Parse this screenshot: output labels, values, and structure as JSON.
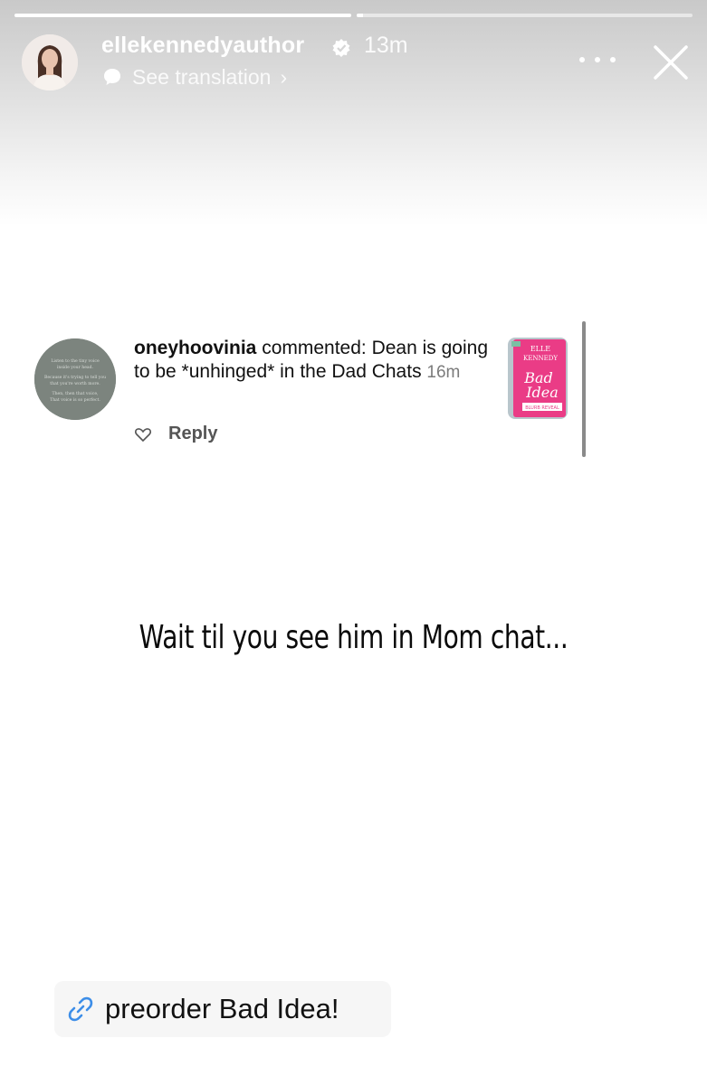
{
  "story": {
    "progress": [
      1.0,
      0.02
    ],
    "username": "ellekennedyauthor",
    "time_ago": "13m",
    "translate_label": "See translation"
  },
  "comment": {
    "username": "oneyhoovinia",
    "text": " commented: Dean is going to be *unhinged* in the Dad Chats",
    "time_ago": "16m",
    "reply_label": "Reply",
    "avatar_quote_lines": [
      "Listen to the tiny voice",
      "inside your head.",
      "Because it's trying to tell you",
      "that you're worth more.",
      "Then, then that voice,",
      "That voice is so perfect."
    ],
    "book": {
      "author": "ELLE KENNEDY",
      "title_line1": "Bad",
      "title_line2": "Idea",
      "tag": "BLURB REVEAL"
    }
  },
  "caption": "Wait til you see him in Mom chat...",
  "link_sticker": {
    "label": "preorder Bad Idea!"
  },
  "colors": {
    "book_pink": "#ea3c86",
    "link_blue": "#3d8ee8"
  }
}
